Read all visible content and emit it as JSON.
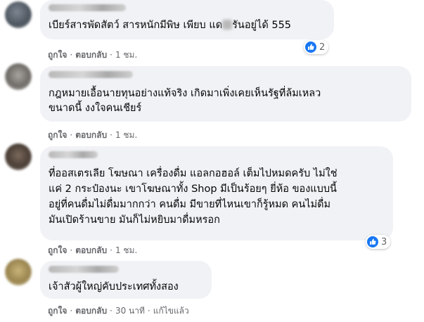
{
  "comments": [
    {
      "text_lines": [
        "เบียร์สารพัดสัตว์ สารหนักมีพิษ เพียบ แด",
        "รันอยู่ได้ 555"
      ],
      "actions": {
        "like": "ถูกใจ",
        "reply": "ตอบกลับ",
        "time": "1 ชม."
      },
      "reaction_count": "2"
    },
    {
      "text_lines": [
        "กฎหมายเอื้อนายทุนอย่างแท้จริง เกิดมาเพิ่งเคยเห็นรัฐที่ล้มเหลว",
        "ขนาดนี้ งงใจคนเชียร์"
      ],
      "actions": {
        "like": "ถูกใจ",
        "reply": "ตอบกลับ",
        "time": "1 ชม."
      }
    },
    {
      "text_lines": [
        "ที่ออสเตรเลีย โฆษณา เครื่องดื่ม แอลกอฮอล์ เต็มไปหมดครับ ไม่ใช่",
        "แค่ 2 กระป๋องนะ เขาโฆษณาทั้ง Shop มีเป็นร้อยๆ ยี่ห้อ ของแบบนี้",
        "อยู่ที่คนดื่มไม่ดื่มมากกว่า คนดื่ม มีขายที่ไหนเขาก็รู้หมด คนไม่ดื่ม",
        "มันเปิดร้านขาย มันก็ไม่หยิบมาดื่มหรอก"
      ],
      "actions": {
        "like": "ถูกใจ",
        "reply": "ตอบกลับ",
        "time": "1 ชม."
      },
      "reaction_count": "3"
    },
    {
      "text_lines": [
        "เจ้าสัวผู้ใหญ่คับประเทศทั้งสอง"
      ],
      "actions": {
        "like": "ถูกใจ",
        "reply": "ตอบกลับ",
        "time": "30 นาที",
        "edited": "แก้ไขแล้ว"
      }
    }
  ],
  "colors": {
    "bubble": "#f0f2f5",
    "meta_text": "#65676b",
    "like_blue": "#1877f2"
  },
  "icons": {
    "reaction": "like-thumb-icon"
  }
}
